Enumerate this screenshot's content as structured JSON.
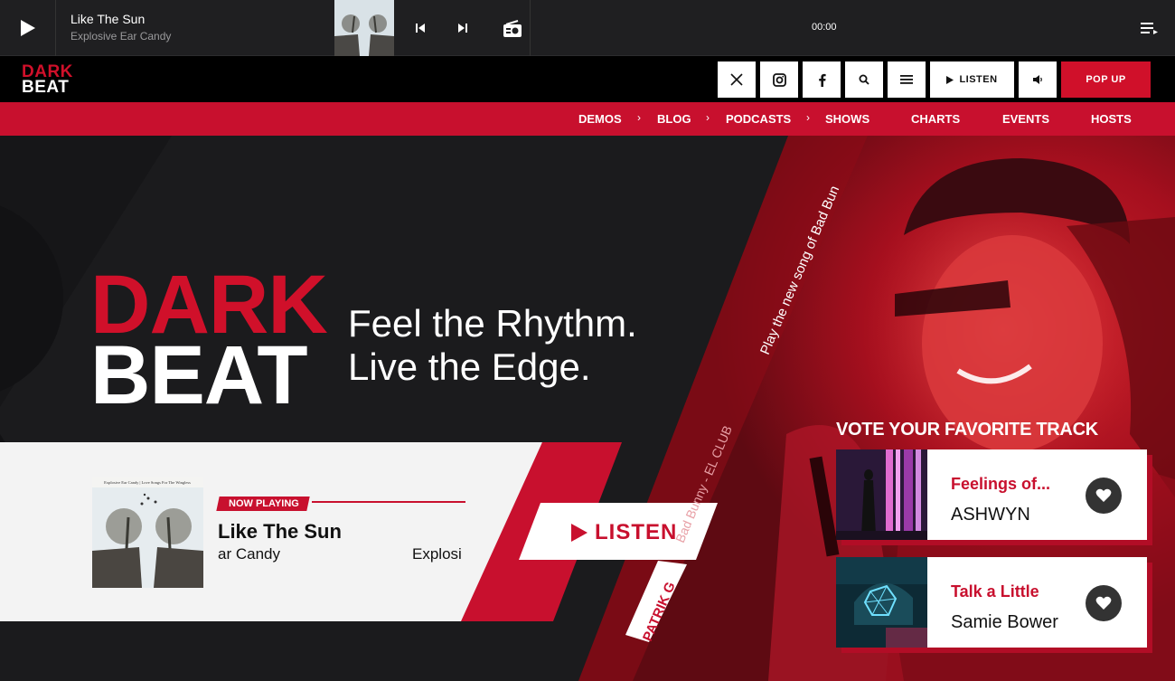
{
  "player": {
    "track_title": "Like The Sun",
    "track_artist": "Explosive Ear Candy",
    "time": "00:00"
  },
  "header": {
    "logo_line1": "DARK",
    "logo_line2": "BEAT",
    "listen_label": "LISTEN",
    "popup_label": "POP UP"
  },
  "nav": {
    "items": [
      "DEMOS",
      "BLOG",
      "PODCASTS",
      "SHOWS",
      "CHARTS",
      "EVENTS",
      "HOSTS"
    ]
  },
  "hero": {
    "logo_line1": "DARK",
    "logo_line2": "BEAT",
    "tagline_line1": "Feel the Rhythm.",
    "tagline_line2": "Live the Edge.",
    "rotated_promo": "Play the new song of Bad Bun",
    "rotated_artist": "Bad Bunny - EL CLUB",
    "rotated_host": "PATRIK G"
  },
  "now_playing": {
    "tag": "NOW PLAYING",
    "cover_caption": "Explosive Ear Candy | Love Songs For The Wingless",
    "track": "Like The Sun",
    "artist_scroll_a": "ar Candy",
    "artist_scroll_b": "Explosi",
    "listen_label": "LISTEN"
  },
  "vote": {
    "title": "VOTE YOUR FAVORITE TRACK",
    "tracks": [
      {
        "title": "Feelings of...",
        "artist": "ASHWYN"
      },
      {
        "title": "Talk a Little",
        "artist": "Samie Bower"
      }
    ]
  },
  "colors": {
    "brand_red": "#c8102e",
    "dark_bg": "#1b1b1d"
  }
}
